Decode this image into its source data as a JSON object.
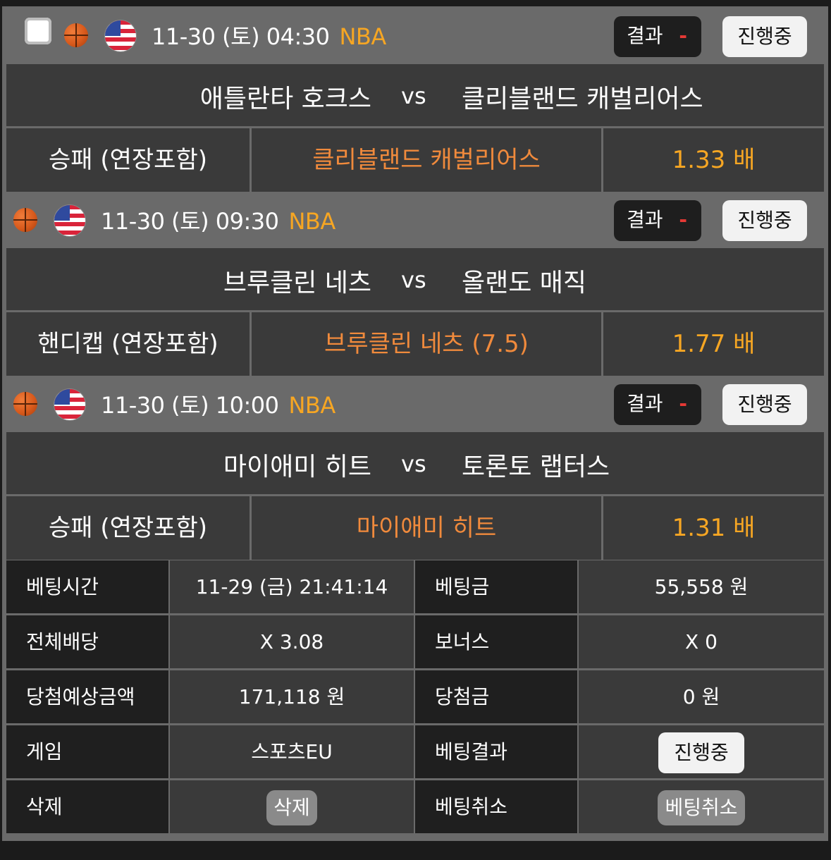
{
  "games": [
    {
      "show_checkbox": true,
      "datetime": "11-30 (토) 04:30",
      "league": "NBA",
      "result_label": "결과",
      "result_value": "-",
      "status": "진행중",
      "home": "애틀란타 호크스",
      "vs": "vs",
      "away": "클리블랜드 캐벌리어스",
      "market": "승패 (연장포함)",
      "pick": "클리블랜드 캐벌리어스",
      "odds": "1.33 배"
    },
    {
      "show_checkbox": false,
      "datetime": "11-30 (토) 09:30",
      "league": "NBA",
      "result_label": "결과",
      "result_value": "-",
      "status": "진행중",
      "home": "브루클린 네츠",
      "vs": "vs",
      "away": "올랜도 매직",
      "market": "핸디캡 (연장포함)",
      "pick": "브루클린 네츠 (7.5)",
      "odds": "1.77 배"
    },
    {
      "show_checkbox": false,
      "datetime": "11-30 (토) 10:00",
      "league": "NBA",
      "result_label": "결과",
      "result_value": "-",
      "status": "진행중",
      "home": "마이애미 히트",
      "vs": "vs",
      "away": "토론토 랩터스",
      "market": "승패 (연장포함)",
      "pick": "마이애미 히트",
      "odds": "1.31 배"
    }
  ],
  "summary": {
    "bet_time_label": "베팅시간",
    "bet_time": "11-29 (금) 21:41:14",
    "bet_amount_label": "베팅금",
    "bet_amount": "55,558 원",
    "total_odds_label": "전체배당",
    "total_odds": "X 3.08",
    "bonus_label": "보너스",
    "bonus": "X 0",
    "expected_win_label": "당첨예상금액",
    "expected_win": "171,118 원",
    "win_amount_label": "당첨금",
    "win_amount": "0 원",
    "game_label": "게임",
    "game": "스포츠EU",
    "bet_result_label": "베팅결과",
    "bet_result": "진행중",
    "delete_label": "삭제",
    "delete_button": "삭제",
    "cancel_label": "베팅취소",
    "cancel_button": "베팅취소"
  },
  "icons": {
    "sport": "basketball-icon",
    "country": "usa-flag-icon"
  },
  "colors": {
    "accent_orange": "#f08a3c",
    "league_yellow": "#f6a623",
    "result_red": "#e53935"
  }
}
